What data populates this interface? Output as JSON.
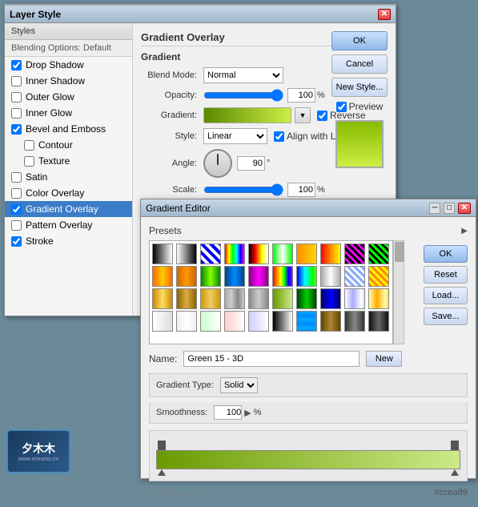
{
  "layerStyleWindow": {
    "title": "Layer Style",
    "stylesHeader": "Styles",
    "blendingOptions": "Blending Options: Default",
    "items": [
      {
        "label": "Drop Shadow",
        "checked": true,
        "active": false,
        "sub": false
      },
      {
        "label": "Inner Shadow",
        "checked": false,
        "active": false,
        "sub": false
      },
      {
        "label": "Outer Glow",
        "checked": false,
        "active": false,
        "sub": false
      },
      {
        "label": "Inner Glow",
        "checked": false,
        "active": false,
        "sub": false
      },
      {
        "label": "Bevel and Emboss",
        "checked": true,
        "active": false,
        "sub": false
      },
      {
        "label": "Contour",
        "checked": false,
        "active": false,
        "sub": true
      },
      {
        "label": "Texture",
        "checked": false,
        "active": false,
        "sub": true
      },
      {
        "label": "Satin",
        "checked": false,
        "active": false,
        "sub": false
      },
      {
        "label": "Color Overlay",
        "checked": false,
        "active": false,
        "sub": false
      },
      {
        "label": "Gradient Overlay",
        "checked": true,
        "active": true,
        "sub": false
      },
      {
        "label": "Pattern Overlay",
        "checked": false,
        "active": false,
        "sub": false
      },
      {
        "label": "Stroke",
        "checked": true,
        "active": false,
        "sub": false
      }
    ],
    "buttons": {
      "ok": "OK",
      "cancel": "Cancel",
      "newStyle": "New Style...",
      "preview": "Preview"
    },
    "gradientOverlay": {
      "sectionTitle": "Gradient Overlay",
      "subTitle": "Gradient",
      "blendMode": {
        "label": "Blend Mode:",
        "value": "Normal"
      },
      "opacity": {
        "label": "Opacity:",
        "value": "100",
        "unit": "%"
      },
      "gradient": {
        "label": "Gradient:",
        "reverseLabel": "Reverse",
        "reverseChecked": true
      },
      "style": {
        "label": "Style:",
        "value": "Linear",
        "alignWithLayer": "Align with Layer",
        "alignChecked": true
      },
      "angle": {
        "label": "Angle:",
        "value": "90",
        "unit": "°"
      },
      "scale": {
        "label": "Scale:",
        "value": "100",
        "unit": "%"
      }
    }
  },
  "gradientEditor": {
    "title": "Gradient Editor",
    "presetsLabel": "Presets",
    "buttons": {
      "ok": "OK",
      "reset": "Reset",
      "load": "Load...",
      "save": "Save..."
    },
    "nameLabel": "Name:",
    "nameValue": "Green 15 - 3D",
    "newBtn": "New",
    "gradientType": {
      "label": "Gradient Type:",
      "value": "Solid"
    },
    "smoothness": {
      "label": "Smoothness:",
      "value": "100",
      "unit": "%"
    },
    "hexValue": "#ccea89",
    "watermark": "www.missvuan.com"
  },
  "logo": {
    "text": "夕木木",
    "url": "www.ximumu.cn"
  }
}
